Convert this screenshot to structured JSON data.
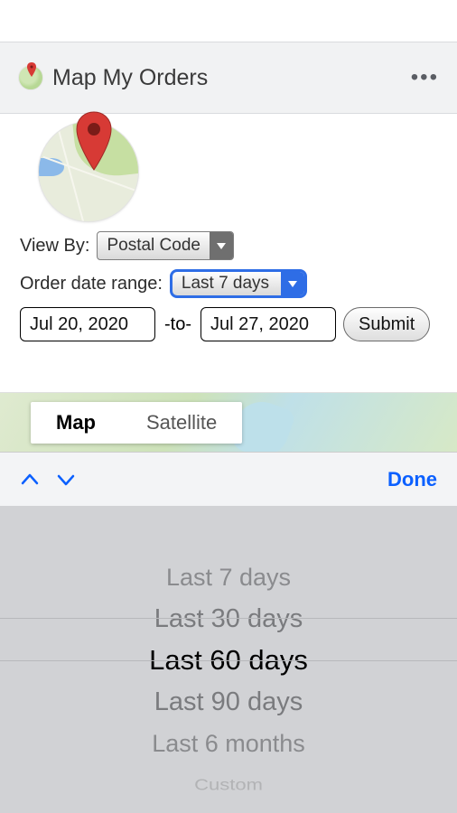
{
  "header": {
    "title": "Map My Orders"
  },
  "filters": {
    "view_by_label": "View By:",
    "view_by_value": "Postal Code",
    "range_label": "Order date range:",
    "range_value": "Last 7 days",
    "date_from": "Jul 20, 2020",
    "date_to": "Jul 27, 2020",
    "to_sep": "-to-",
    "submit_label": "Submit"
  },
  "map": {
    "tab_map": "Map",
    "tab_satellite": "Satellite",
    "active_tab": "map"
  },
  "picker": {
    "done_label": "Done",
    "options": [
      "Last 7 days",
      "Last 30 days",
      "Last 60 days",
      "Last 90 days",
      "Last 6 months",
      "Custom"
    ],
    "selected": "Last 60 days"
  }
}
